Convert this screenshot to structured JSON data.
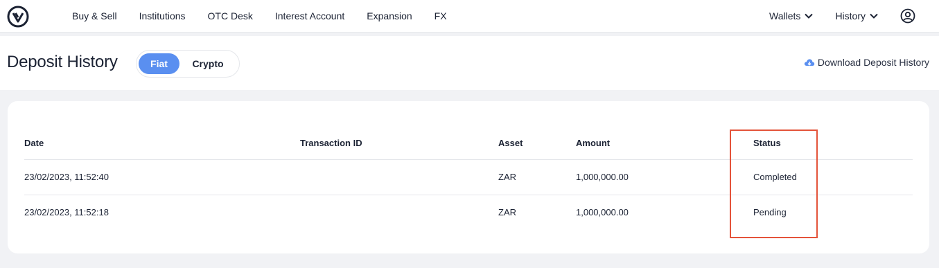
{
  "nav": {
    "links": [
      "Buy & Sell",
      "Institutions",
      "OTC Desk",
      "Interest Account",
      "Expansion",
      "FX"
    ],
    "wallets_label": "Wallets",
    "history_label": "History"
  },
  "header": {
    "title": "Deposit History",
    "toggle": {
      "active": "Fiat",
      "inactive": "Crypto"
    },
    "download_label": "Download Deposit History"
  },
  "table": {
    "columns": [
      "Date",
      "Transaction ID",
      "Asset",
      "Amount",
      "Status"
    ],
    "rows": [
      {
        "date": "23/02/2023, 11:52:40",
        "tx_id": "",
        "asset": "ZAR",
        "amount": "1,000,000.00",
        "status": "Completed"
      },
      {
        "date": "23/02/2023, 11:52:18",
        "tx_id": "",
        "asset": "ZAR",
        "amount": "1,000,000.00",
        "status": "Pending"
      }
    ]
  },
  "colors": {
    "accent": "#5a8ff0",
    "highlight": "#e4533a",
    "text": "#1b2233",
    "background": "#f1f2f5"
  },
  "icons": [
    "logo-icon",
    "chevron-down-icon",
    "user-circle-icon",
    "cloud-download-icon"
  ]
}
